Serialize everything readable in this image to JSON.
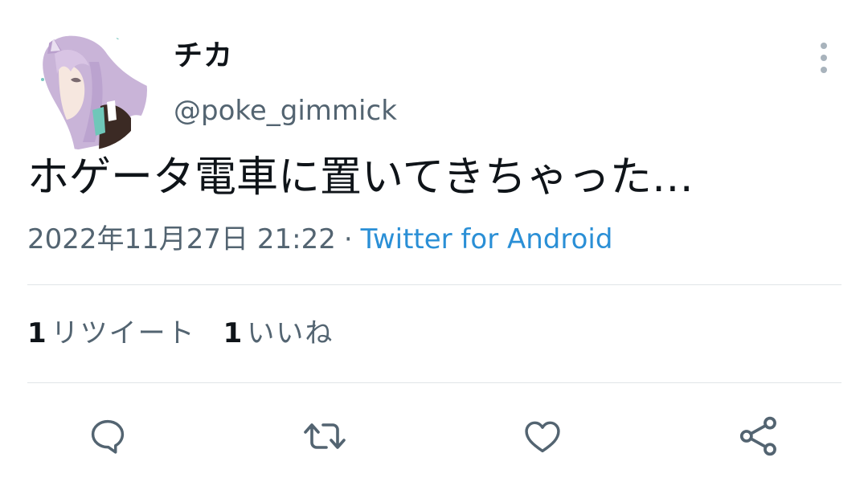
{
  "tweet": {
    "display_name": "チカ",
    "handle": "@poke_gimmick",
    "text": "ホゲータ電車に置いてきちゃった…",
    "timestamp": "2022年11月27日 21:22",
    "separator": "·",
    "source": "Twitter for Android",
    "retweets": {
      "count": "1",
      "label": "リツイート"
    },
    "likes": {
      "count": "1",
      "label": "いいね"
    }
  },
  "icons": {
    "more": "more-vertical-icon",
    "reply": "reply-icon",
    "retweet": "retweet-icon",
    "like": "heart-icon",
    "share": "share-icon"
  },
  "colors": {
    "text_primary": "#0f1419",
    "text_secondary": "#536471",
    "link": "#2a8fd6",
    "icon": "#536471",
    "divider": "#e1e5e8"
  }
}
